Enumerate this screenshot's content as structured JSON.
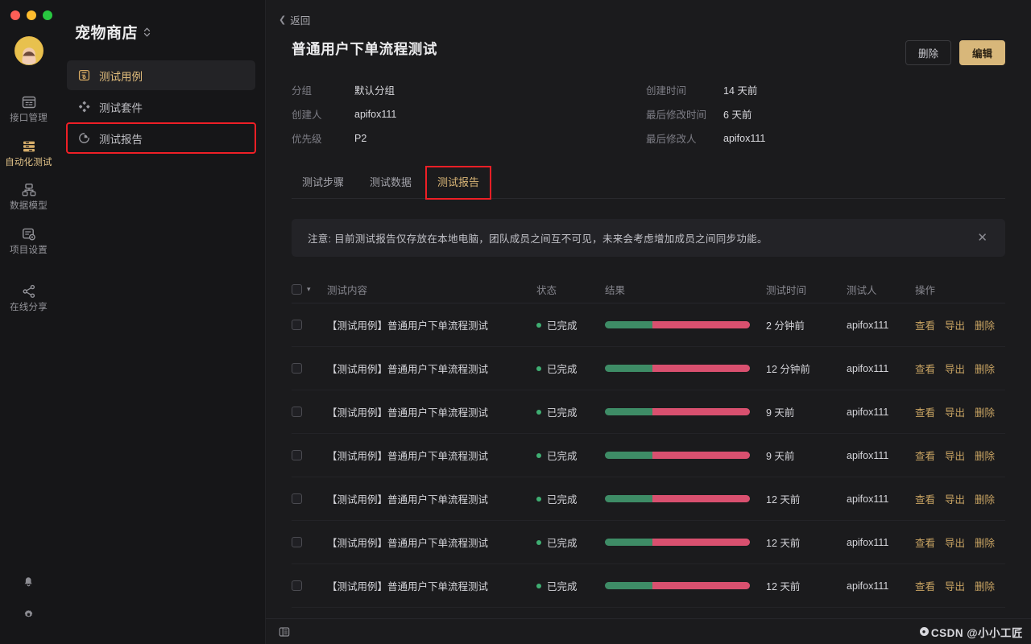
{
  "window": {
    "traffic_lights": [
      "close",
      "minimize",
      "zoom"
    ],
    "colors": {
      "close": "#ff5f57",
      "minimize": "#febc2e",
      "zoom": "#28c840",
      "accent_gold": "#d8b77a",
      "pass_green": "#3e8c66",
      "fail_pink": "#d9506f",
      "highlight_red": "#ee1f26"
    }
  },
  "rail": {
    "avatar_name": "user-avatar",
    "items": [
      {
        "label": "接口管理",
        "icon": "api-window-icon",
        "active": false
      },
      {
        "label": "自动化测试",
        "icon": "layers-stack-icon",
        "active": true
      },
      {
        "label": "数据模型",
        "icon": "data-model-icon",
        "active": false
      },
      {
        "label": "项目设置",
        "icon": "project-settings-icon",
        "active": false
      },
      {
        "label": "在线分享",
        "icon": "share-nodes-icon",
        "active": false
      }
    ],
    "bottom_icons": [
      {
        "name": "bell-icon"
      },
      {
        "name": "gear-icon"
      }
    ]
  },
  "sidebar": {
    "project_name": "宠物商店",
    "project_caret": "chevron-updown-icon",
    "items": [
      {
        "label": "测试用例",
        "icon": "test-case-icon",
        "active": true,
        "highlighted": false
      },
      {
        "label": "测试套件",
        "icon": "test-suite-icon",
        "active": false,
        "highlighted": false
      },
      {
        "label": "测试报告",
        "icon": "pie-report-icon",
        "active": false,
        "highlighted": true
      }
    ]
  },
  "main": {
    "back_label": "返回",
    "title": "普通用户下单流程测试",
    "actions": {
      "delete": "删除",
      "edit": "编辑"
    },
    "meta_left": [
      {
        "label": "分组",
        "value": "默认分组"
      },
      {
        "label": "创建人",
        "value": "apifox111"
      },
      {
        "label": "优先级",
        "value": "P2"
      }
    ],
    "meta_right": [
      {
        "label": "创建时间",
        "value": "14 天前"
      },
      {
        "label": "最后修改时间",
        "value": "6 天前"
      },
      {
        "label": "最后修改人",
        "value": "apifox111"
      }
    ],
    "tabs": [
      {
        "label": "测试步骤",
        "active": false,
        "highlighted": false
      },
      {
        "label": "测试数据",
        "active": false,
        "highlighted": false
      },
      {
        "label": "测试报告",
        "active": true,
        "highlighted": true
      }
    ],
    "notice": {
      "text": "注意: 目前测试报告仅存放在本地电脑，团队成员之间互不可见，未来会考虑增加成员之间同步功能。",
      "close_icon": "close-icon"
    },
    "table": {
      "headers": {
        "content": "测试内容",
        "state": "状态",
        "result": "结果",
        "time": "测试时间",
        "user": "测试人",
        "ops": "操作"
      },
      "ops_labels": {
        "view": "查看",
        "export": "导出",
        "delete": "删除"
      },
      "rows": [
        {
          "content": "【测试用例】普通用户下单流程测试",
          "state": "已完成",
          "pass_pct": 33,
          "fail_pct": 67,
          "time": "2 分钟前",
          "user": "apifox111"
        },
        {
          "content": "【测试用例】普通用户下单流程测试",
          "state": "已完成",
          "pass_pct": 33,
          "fail_pct": 67,
          "time": "12 分钟前",
          "user": "apifox111"
        },
        {
          "content": "【测试用例】普通用户下单流程测试",
          "state": "已完成",
          "pass_pct": 33,
          "fail_pct": 67,
          "time": "9 天前",
          "user": "apifox111"
        },
        {
          "content": "【测试用例】普通用户下单流程测试",
          "state": "已完成",
          "pass_pct": 33,
          "fail_pct": 67,
          "time": "9 天前",
          "user": "apifox111"
        },
        {
          "content": "【测试用例】普通用户下单流程测试",
          "state": "已完成",
          "pass_pct": 33,
          "fail_pct": 67,
          "time": "12 天前",
          "user": "apifox111"
        },
        {
          "content": "【测试用例】普通用户下单流程测试",
          "state": "已完成",
          "pass_pct": 33,
          "fail_pct": 67,
          "time": "12 天前",
          "user": "apifox111"
        },
        {
          "content": "【测试用例】普通用户下单流程测试",
          "state": "已完成",
          "pass_pct": 33,
          "fail_pct": 67,
          "time": "12 天前",
          "user": "apifox111"
        }
      ]
    }
  },
  "footer": {
    "left_icon": "panel-toggle-icon",
    "watermark": "CSDN @小小工匠"
  }
}
